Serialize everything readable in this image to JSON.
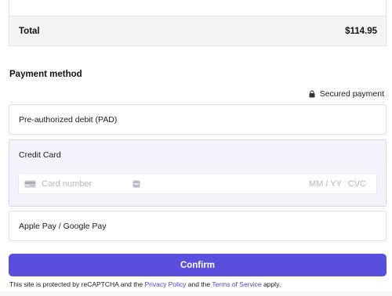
{
  "summary": {
    "total_label": "Total",
    "total_value": "$114.95"
  },
  "payment": {
    "title": "Payment method",
    "secured_label": "Secured payment",
    "options": {
      "pad": "Pre-authorized debit (PAD)",
      "card": "Credit Card",
      "wallet": "Apple Pay / Google Pay"
    },
    "card_fields": {
      "number_placeholder": "Card number",
      "expiry_placeholder": "MM / YY",
      "cvc_placeholder": "CVC"
    }
  },
  "confirm_label": "Confirm",
  "legal": {
    "prefix": "This site is protected by reCAPTCHA and the",
    "privacy": "Privacy Policy",
    "middle": "and the",
    "terms": "Terms of Service",
    "suffix": "apply."
  },
  "icons": {
    "lock": "lock-icon",
    "card": "credit-card-icon",
    "autofill": "autofill-icon"
  },
  "colors": {
    "accent": "#5a4fdc",
    "link": "#4b45c9",
    "selected_bg": "#f4f3fb"
  }
}
